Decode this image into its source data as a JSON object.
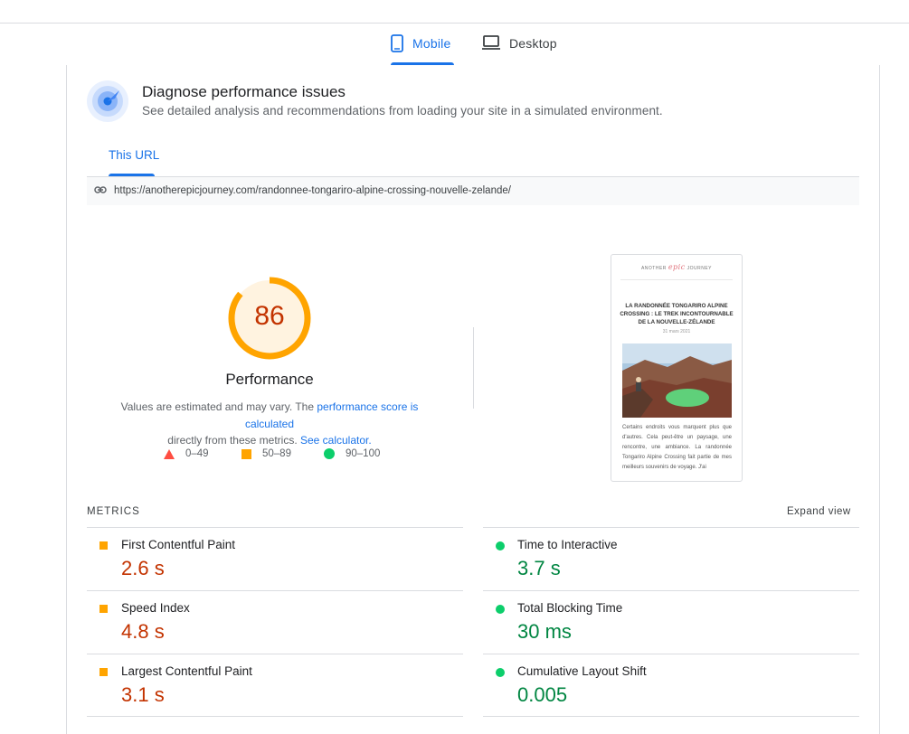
{
  "tabs": {
    "mobile": "Mobile",
    "desktop": "Desktop"
  },
  "diagnose": {
    "title": "Diagnose performance issues",
    "subtitle": "See detailed analysis and recommendations from loading your site in a simulated environment."
  },
  "url_tab": "This URL",
  "url": "https://anotherepicjourney.com/randonnee-tongariro-alpine-crossing-nouvelle-zelande/",
  "score": {
    "value": "86",
    "fraction": 0.86,
    "label": "Performance",
    "note_prefix": "Values are estimated and may vary. The ",
    "note_link1": "performance score is calculated",
    "note_middle": "directly from these metrics. ",
    "note_link2": "See calculator."
  },
  "legend": [
    {
      "range": "0–49",
      "color": "#ff4e42",
      "shape": "triangle"
    },
    {
      "range": "50–89",
      "color": "#ffa400",
      "shape": "square"
    },
    {
      "range": "90–100",
      "color": "#0cce6b",
      "shape": "circle"
    }
  ],
  "screenshot": {
    "brand_left": "ANOTHER",
    "brand_mid": "epic",
    "brand_right": "JOURNEY",
    "title": "LA RANDONNÉE TONGARIRO ALPINE CROSSING : LE TREK INCONTOURNABLE DE LA NOUVELLE-ZÉLANDE",
    "date": "31 mars 2021",
    "body": "Certains endroits vous marquent plus que d'autres. Cela peut-être un paysage, une rencontre, une ambiance. La randonnée Tongariro Alpine Crossing fait partie de mes meilleurs souvenirs de voyage. J'ai"
  },
  "metrics_header": "METRICS",
  "expand_label": "Expand view",
  "metrics_left": [
    {
      "label": "First Contentful Paint",
      "value": "2.6 s",
      "status": "orange"
    },
    {
      "label": "Speed Index",
      "value": "4.8 s",
      "status": "orange"
    },
    {
      "label": "Largest Contentful Paint",
      "value": "3.1 s",
      "status": "orange"
    }
  ],
  "metrics_right": [
    {
      "label": "Time to Interactive",
      "value": "3.7 s",
      "status": "green"
    },
    {
      "label": "Total Blocking Time",
      "value": "30 ms",
      "status": "green"
    },
    {
      "label": "Cumulative Layout Shift",
      "value": "0.005",
      "status": "green"
    }
  ],
  "colors": {
    "accent": "#1a73e8",
    "average": "#ffa400",
    "average_text": "#c33300",
    "pass": "#0cce6b",
    "pass_text": "#018642",
    "fail": "#ff4e42"
  }
}
